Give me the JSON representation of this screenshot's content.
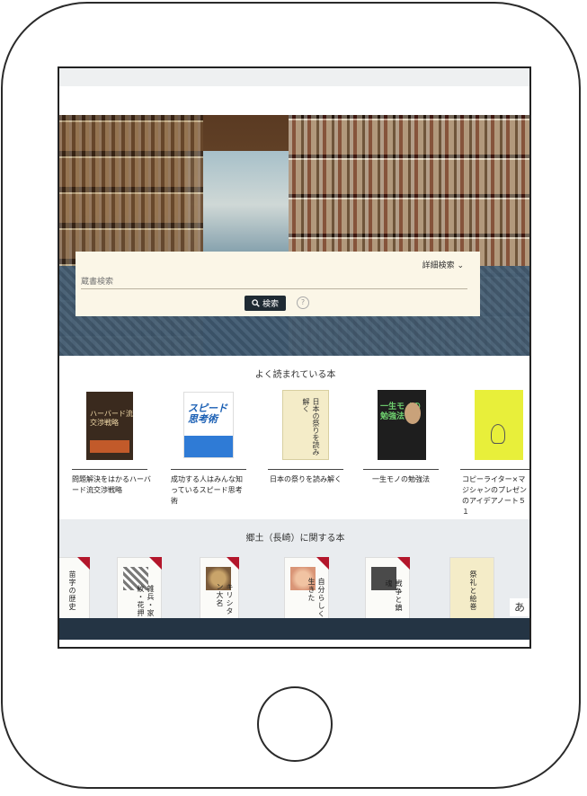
{
  "search": {
    "advanced_label": "詳細検索",
    "placeholder": "蔵書検索",
    "button_label": "検索",
    "help_label": "?"
  },
  "popular": {
    "title": "よく読まれている本",
    "books": [
      {
        "caption": "問題解決をはかるハーバード流交渉戦略",
        "cover_text": "ハーバード流\n交渉戦略"
      },
      {
        "caption": "成功する人はみんな知っているスピード思考術",
        "cover_text": "スピード\n思考術"
      },
      {
        "caption": "日本の祭りを読み解く",
        "cover_text": "日本の祭りを読み解く"
      },
      {
        "caption": "一生モノの勉強法",
        "cover_text": "一生モノの\n勉強法"
      },
      {
        "caption": "コピーライター×マジシャンのプレゼンのアイデアノート５１",
        "cover_text": ""
      }
    ]
  },
  "local": {
    "title": "郷土（長崎）に関する本",
    "books": [
      {
        "cover_text": "苗字の歴史"
      },
      {
        "cover_text": "雑兵・家紋・花押"
      },
      {
        "cover_text": "キリシタン大名"
      },
      {
        "cover_text": "自分らしく生きた"
      },
      {
        "cover_text": "戦争と鎮魂"
      },
      {
        "cover_text": "祭礼と絵巻"
      }
    ]
  },
  "ime_indicator": "あ"
}
